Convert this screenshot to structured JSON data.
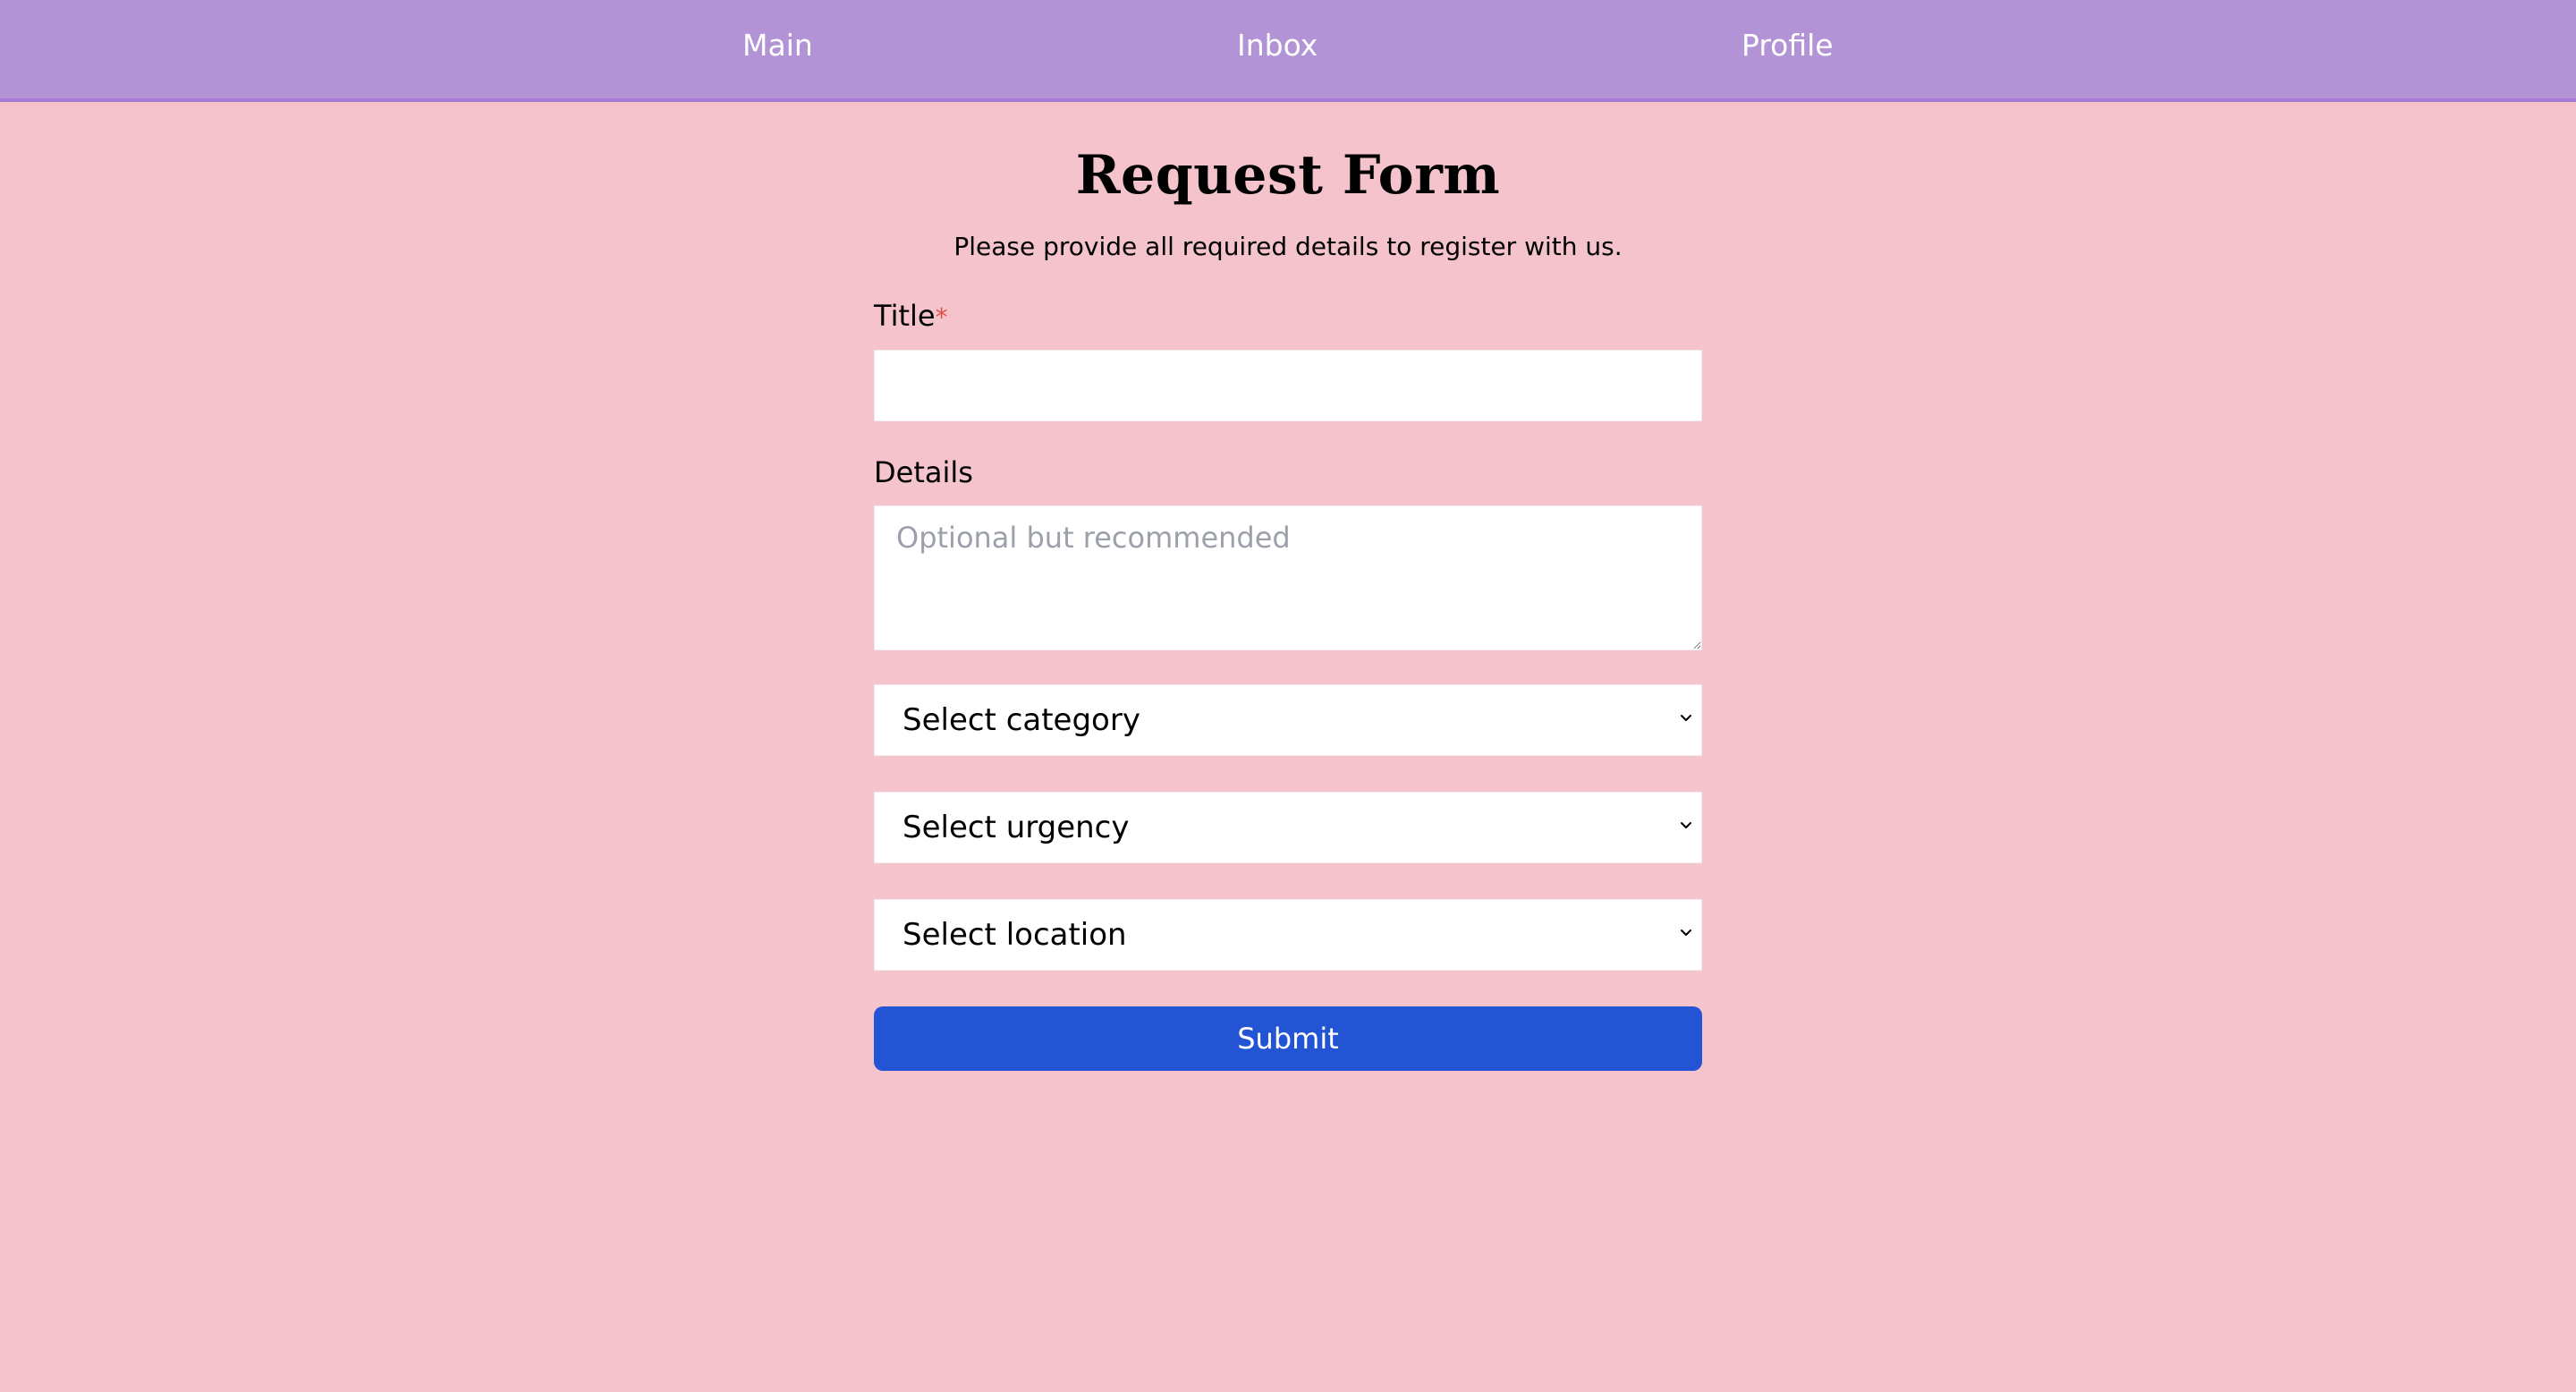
{
  "nav": {
    "items": [
      {
        "label": "Main"
      },
      {
        "label": "Inbox"
      },
      {
        "label": "Profile"
      }
    ]
  },
  "form": {
    "title": "Request Form",
    "subtitle": "Please provide all required details to register with us.",
    "title_field": {
      "label": "Title",
      "required_mark": "*",
      "value": ""
    },
    "details_field": {
      "label": "Details",
      "placeholder": "Optional but recommended",
      "value": ""
    },
    "selects": [
      {
        "value": "Select category"
      },
      {
        "value": "Select urgency"
      },
      {
        "value": "Select location"
      }
    ],
    "submit_label": "Submit"
  },
  "colors": {
    "page_background": "#f4c3cc",
    "nav_background": "#b293d6",
    "submit_button": "#2354d4",
    "required_mark": "#e0504a"
  },
  "icons": {
    "select_chevron": "chevron-down-icon"
  }
}
